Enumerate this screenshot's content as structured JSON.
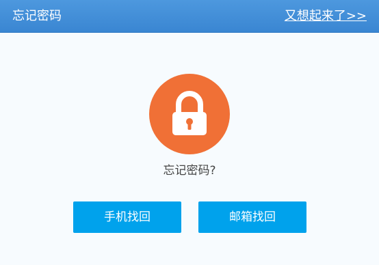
{
  "header": {
    "title": "忘记密码",
    "remembered_link": "又想起来了>>"
  },
  "main": {
    "icon": "lock-icon",
    "question": "忘记密码?",
    "phone_button": "手机找回",
    "email_button": "邮箱找回"
  },
  "colors": {
    "header": "#3a86d2",
    "lock_circle": "#f07036",
    "button": "#00a2ec",
    "background": "#f7fbfe"
  }
}
